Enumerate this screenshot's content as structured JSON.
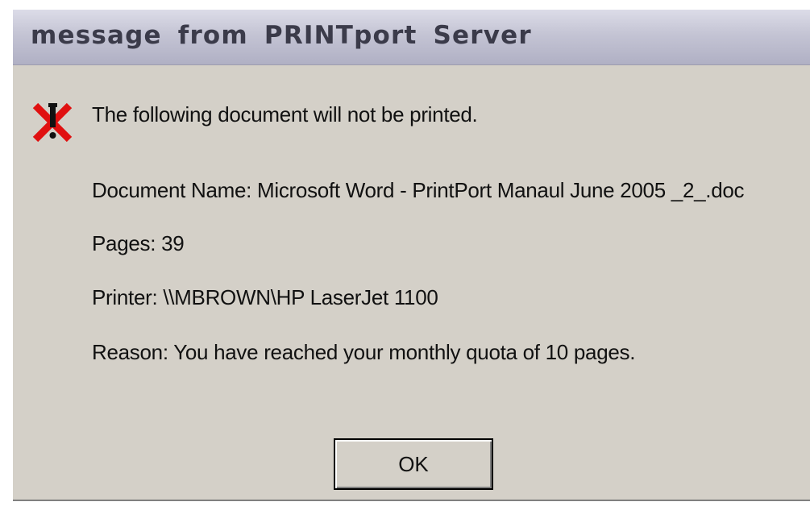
{
  "dialog": {
    "title": "message  from  PRINTport  Server",
    "icon": "error-x-icon",
    "message": "The following document will not be printed.",
    "document_line": "Document Name: Microsoft Word - PrintPort Manaul June 2005 _2_.doc",
    "pages_line": "Pages: 39",
    "printer_line": "Printer: \\\\MBROWN\\HP LaserJet 1100",
    "reason_line": "Reason: You have reached your monthly quota of 10 pages.",
    "ok_label": "OK"
  },
  "colors": {
    "dialog_bg": "#d4d0c8",
    "title_text": "#3b3b4a",
    "icon_red": "#e01010"
  }
}
